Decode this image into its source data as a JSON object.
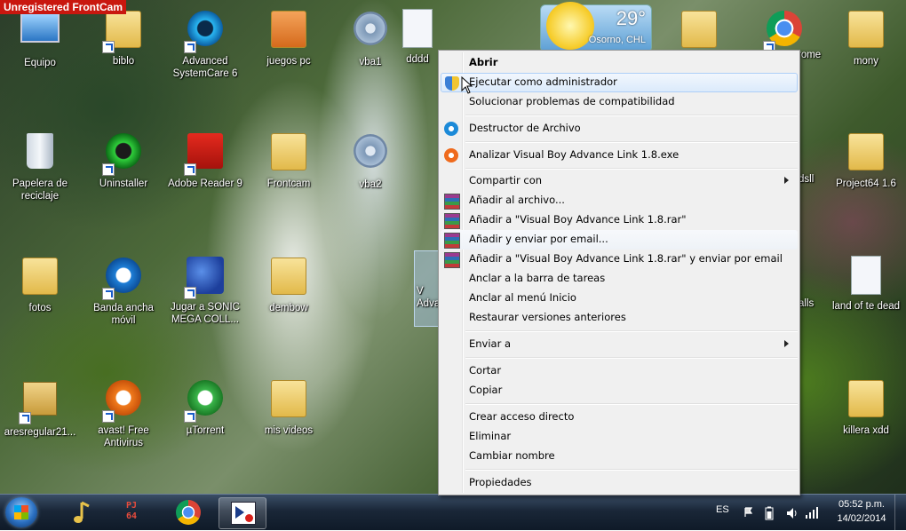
{
  "watermark": "Unregistered FrontCam",
  "weather": {
    "temp": "29°",
    "city": "Osorno, CHL"
  },
  "desktop_icons": [
    {
      "label": "Equipo"
    },
    {
      "label": "biblo"
    },
    {
      "label": "Advanced SystemCare 6"
    },
    {
      "label": "juegos pc"
    },
    {
      "label": "vba1"
    },
    {
      "label": "dddd"
    },
    {
      "label": "Papelera de reciclaje"
    },
    {
      "label": "Uninstaller"
    },
    {
      "label": "Adobe Reader 9"
    },
    {
      "label": "Frontcam"
    },
    {
      "label": "vba2"
    },
    {
      "label": "fotos"
    },
    {
      "label": "Banda ancha móvil"
    },
    {
      "label": "Jugar a SONIC MEGA COLL..."
    },
    {
      "label": "dembow"
    },
    {
      "label": "aresregular21..."
    },
    {
      "label": "avast! Free Antivirus"
    },
    {
      "label": "µTorrent"
    },
    {
      "label": "mis videos"
    },
    {
      "label": "rome"
    },
    {
      "label": "mony"
    },
    {
      "label": "dsll"
    },
    {
      "label": "Project64 1.6"
    },
    {
      "label": "alls"
    },
    {
      "label": "land of te dead"
    },
    {
      "label": "killera xdd"
    },
    {
      "label": "V Adva"
    }
  ],
  "context_menu": {
    "items": [
      {
        "label": "Abrir"
      },
      {
        "label": "Ejecutar como administrador"
      },
      {
        "label": "Solucionar problemas de compatibilidad"
      },
      {
        "label": "Destructor de Archivo"
      },
      {
        "label": "Analizar Visual Boy Advance Link 1.8.exe"
      },
      {
        "label": "Compartir con"
      },
      {
        "label": "Añadir al archivo..."
      },
      {
        "label": "Añadir a \"Visual Boy Advance Link 1.8.rar\""
      },
      {
        "label": "Añadir y enviar por email..."
      },
      {
        "label": "Añadir a \"Visual Boy Advance Link 1.8.rar\" y enviar por email"
      },
      {
        "label": "Anclar a la barra de tareas"
      },
      {
        "label": "Anclar al menú Inicio"
      },
      {
        "label": "Restaurar versiones anteriores"
      },
      {
        "label": "Enviar a"
      },
      {
        "label": "Cortar"
      },
      {
        "label": "Copiar"
      },
      {
        "label": "Crear acceso directo"
      },
      {
        "label": "Eliminar"
      },
      {
        "label": "Cambiar nombre"
      },
      {
        "label": "Propiedades"
      }
    ]
  },
  "taskbar": {
    "pj64_label": "PJ\n64",
    "language": "ES",
    "time": "05:52 p.m.",
    "date": "14/02/2014"
  }
}
